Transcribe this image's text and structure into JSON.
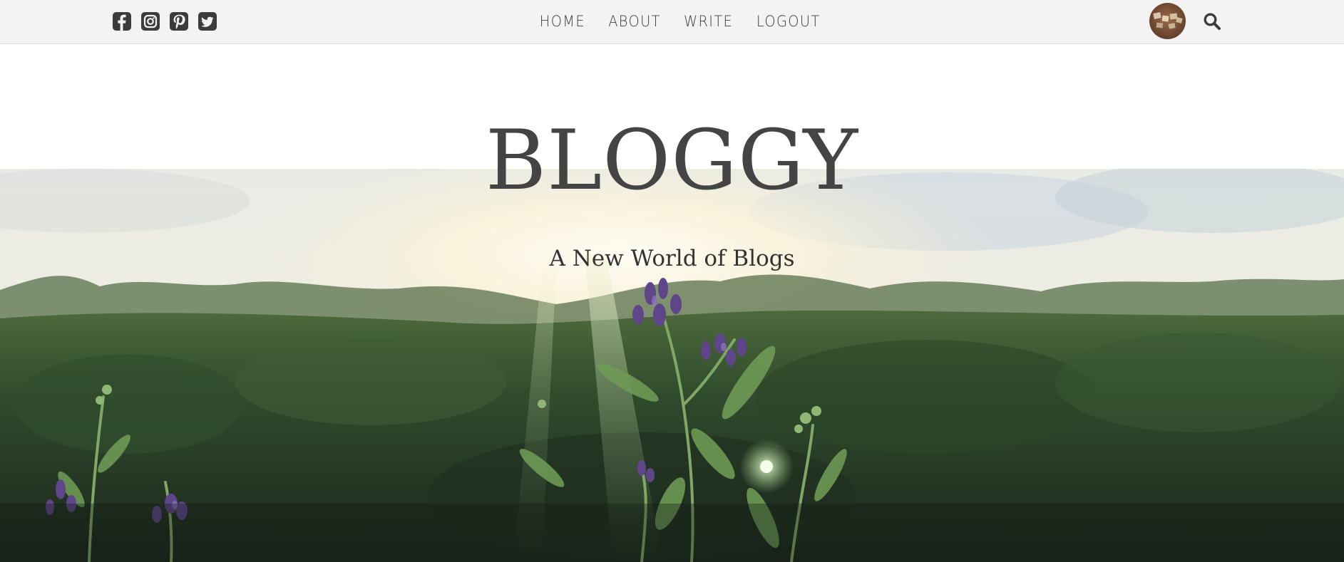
{
  "social": {
    "icons": [
      "facebook-square-icon",
      "instagram-square-icon",
      "pinterest-square-icon",
      "twitter-square-icon"
    ]
  },
  "nav": {
    "items": [
      {
        "label": "HOME"
      },
      {
        "label": "ABOUT"
      },
      {
        "label": "WRITE"
      },
      {
        "label": "LOGOUT"
      }
    ]
  },
  "user": {
    "avatar_icon": "user-avatar"
  },
  "search": {
    "icon": "search-icon"
  },
  "header": {
    "title": "BLOGGY",
    "tagline": "A New World of Blogs"
  },
  "theme": {
    "topbar_bg": "#f3f3f3",
    "text_color": "#444444"
  }
}
